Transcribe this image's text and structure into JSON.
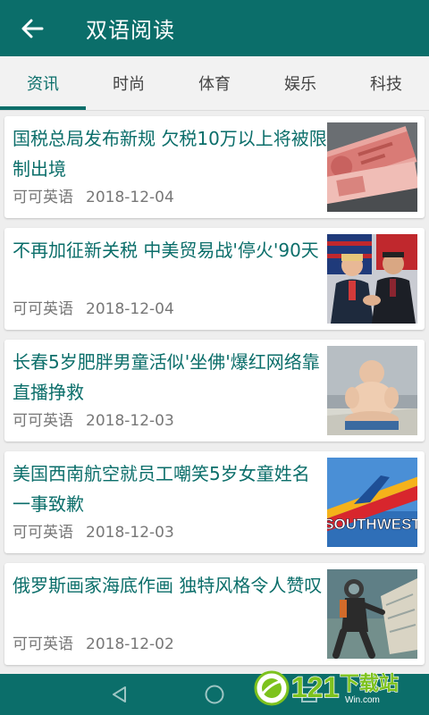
{
  "header": {
    "title": "双语阅读"
  },
  "tabs": [
    {
      "label": "资讯",
      "active": true
    },
    {
      "label": "时尚",
      "active": false
    },
    {
      "label": "体育",
      "active": false
    },
    {
      "label": "娱乐",
      "active": false
    },
    {
      "label": "科技",
      "active": false
    }
  ],
  "articles": [
    {
      "title": "国税总局发布新规 欠税10万以上将被限制出境",
      "source": "可可英语",
      "date": "2018-12-04",
      "thumb_icon": "banknotes-icon"
    },
    {
      "title": "不再加征新关税 中美贸易战'停火'90天",
      "source": "可可英语",
      "date": "2018-12-04",
      "thumb_icon": "leaders-handshake-icon"
    },
    {
      "title": "长春5岁肥胖男童活似'坐佛'爆红网络靠直播挣救",
      "source": "可可英语",
      "date": "2018-12-03",
      "thumb_icon": "child-photo-icon"
    },
    {
      "title": "美国西南航空就员工嘲笑5岁女童姓名一事致歉",
      "source": "可可英语",
      "date": "2018-12-03",
      "thumb_icon": "airplane-icon",
      "thumb_text": "SOUTHWEST"
    },
    {
      "title": "俄罗斯画家海底作画 独特风格令人赞叹",
      "source": "可可英语",
      "date": "2018-12-02",
      "thumb_icon": "diver-painting-icon"
    }
  ],
  "watermark": {
    "number": "121",
    "text": "下载站",
    "url": "Win.com"
  },
  "colors": {
    "primary": "#0b6e6a",
    "watermark_green": "#7dc21e"
  }
}
